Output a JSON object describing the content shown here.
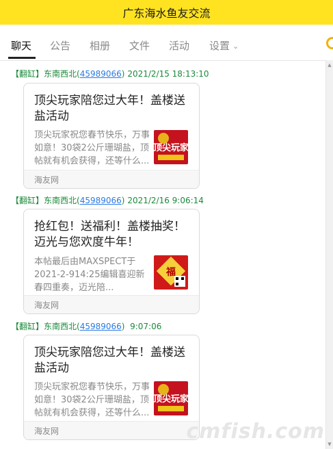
{
  "window": {
    "title": "广东海水鱼友交流"
  },
  "tabs": [
    {
      "label": "聊天"
    },
    {
      "label": "公告"
    },
    {
      "label": "相册"
    },
    {
      "label": "文件"
    },
    {
      "label": "活动"
    },
    {
      "label": "设置"
    }
  ],
  "messages": [
    {
      "tag": "【翻缸】",
      "sender": "东南西北",
      "qq_prefix": "(",
      "qq": "45989066",
      "qq_suffix": ")",
      "time": "2021/2/15 18:13:10",
      "card": {
        "title": "顶尖玩家陪您过大年！盖楼送盐活动",
        "desc": "顶尖玩家祝您春节快乐，万事如意！30袋2公斤珊瑚盐，顶帖就有机会获得，还等什么...",
        "source": "海友网",
        "thumb_text": "顶尖玩家"
      }
    },
    {
      "tag": "【翻缸】",
      "sender": "东南西北",
      "qq_prefix": "(",
      "qq": "45989066",
      "qq_suffix": ")",
      "time": "2021/2/16 9:06:14",
      "card": {
        "title": "抢红包！送福利！盖楼抽奖！迈光与您欢度牛年！",
        "desc": "本帖最后由MAXSPECT于2021-2-914:25编辑喜迎新春四重奏，迈光陪...",
        "source": "海友网",
        "thumb_text": "福"
      }
    },
    {
      "tag": "【翻缸】",
      "sender": "东南西北",
      "qq_prefix": "(",
      "qq": "45989066",
      "qq_suffix": ")",
      "time": "9:07:06",
      "card": {
        "title": "顶尖玩家陪您过大年！盖楼送盐活动",
        "desc": "顶尖玩家祝您春节快乐，万事如意！30袋2公斤珊瑚盐，顶帖就有机会获得，还等什么...",
        "source": "海友网",
        "thumb_text": "顶尖玩家"
      }
    }
  ],
  "watermark": "cmfish.com",
  "colors": {
    "titlebar": "#ffe321",
    "meta_green": "#1b8a3a",
    "link_blue": "#2a7ae2"
  }
}
